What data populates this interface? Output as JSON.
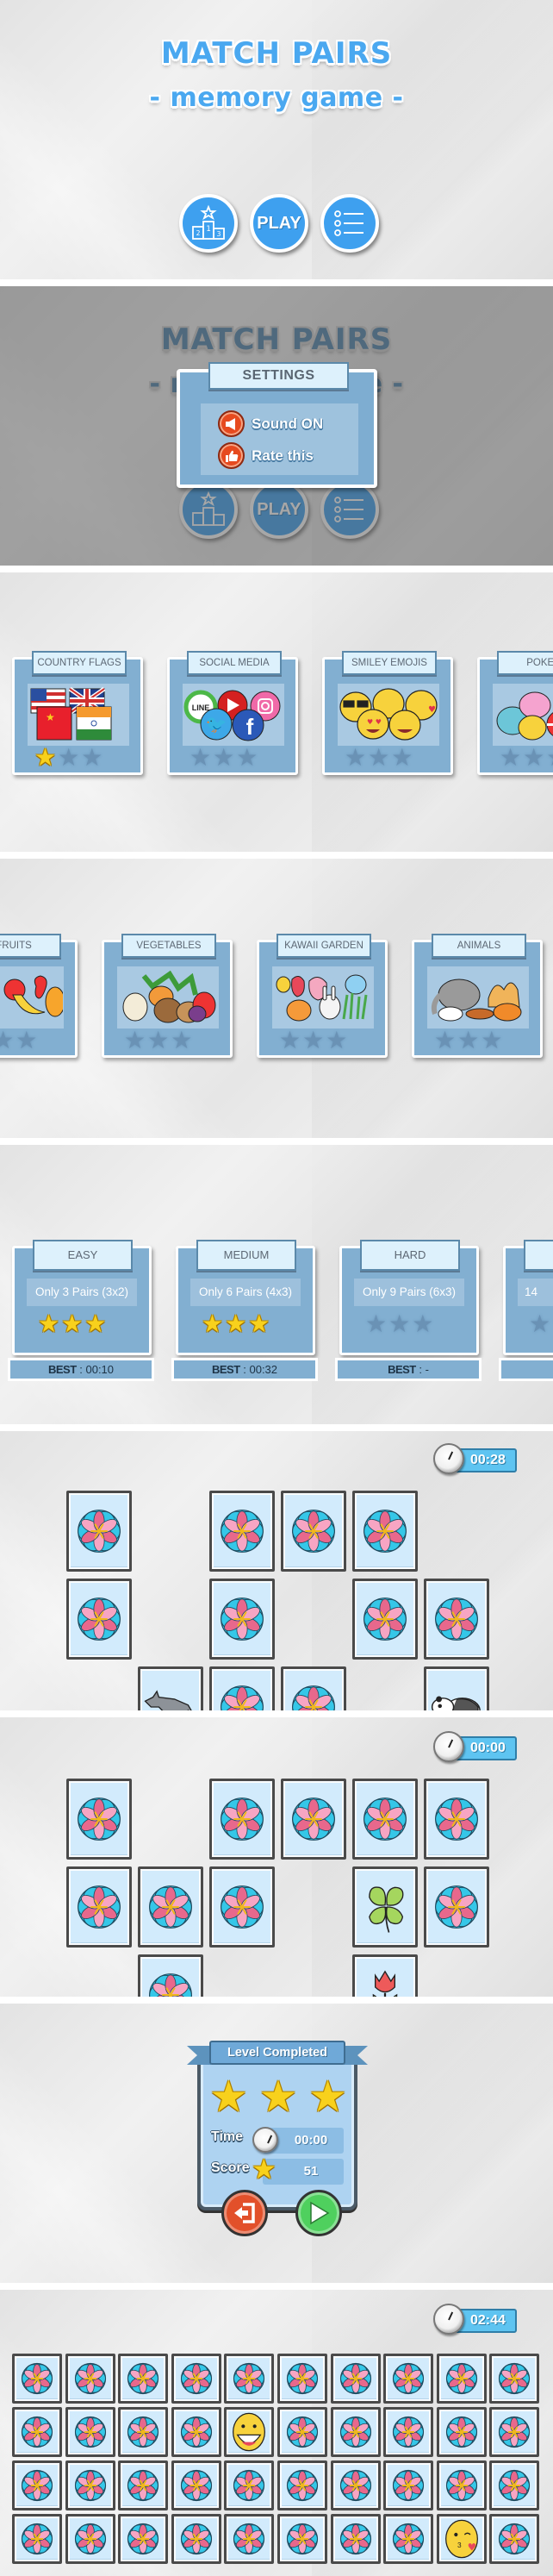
{
  "screens": {
    "main_menu": {
      "title": "MATCH PAIRS",
      "subtitle": "- memory game -",
      "buttons": {
        "leaderboard_icon": "podium-icon",
        "play_label": "PLAY",
        "menu_icon": "list-icon"
      }
    },
    "settings": {
      "title": "MATCH PAIRS",
      "subtitle": "- memory game -",
      "popup_title": "SETTINGS",
      "items": [
        {
          "label": "Sound ON",
          "icon": "speaker-icon"
        },
        {
          "label": "Rate this",
          "icon": "thumbs-up-icon"
        }
      ],
      "play_label": "PLAY"
    },
    "categories_1": {
      "cards": [
        {
          "title": "COUNTRY FLAGS",
          "stars": 1,
          "art": "flags"
        },
        {
          "title": "SOCIAL MEDIA",
          "stars": 0,
          "art": "social"
        },
        {
          "title": "SMILEY EMOJIS",
          "stars": 0,
          "art": "emoji"
        },
        {
          "title": "POKEM",
          "stars": 0,
          "art": "pokemon"
        }
      ]
    },
    "categories_2": {
      "cards": [
        {
          "title": "FRUITS",
          "stars": 0,
          "art": "fruits"
        },
        {
          "title": "VEGETABLES",
          "stars": 0,
          "art": "vegetables"
        },
        {
          "title": "KAWAII GARDEN",
          "stars": 0,
          "art": "garden"
        },
        {
          "title": "ANIMALS",
          "stars": 0,
          "art": "animals"
        }
      ]
    },
    "difficulty": {
      "best_label": "BEST",
      "cards": [
        {
          "title": "EASY",
          "desc": "Only 3 Pairs (3x2)",
          "stars": 3,
          "best": ": 00:10"
        },
        {
          "title": "MEDIUM",
          "desc": "Only 6 Pairs (4x3)",
          "stars": 3,
          "best": ": 00:32"
        },
        {
          "title": "HARD",
          "desc": "Only 9 Pairs (6x3)",
          "stars": 0,
          "best": ": -"
        },
        {
          "title": "",
          "desc": "14",
          "stars": 0,
          "best": ""
        }
      ]
    },
    "game_1": {
      "timer": "00:28",
      "columns": 6,
      "rows": [
        [
          "back",
          "",
          "back",
          "back",
          "back",
          ""
        ],
        [
          "back",
          "",
          "back",
          "",
          "back",
          "back"
        ],
        [
          "",
          "wolf",
          "back",
          "back",
          "",
          "panda"
        ]
      ]
    },
    "game_2": {
      "timer": "00:00",
      "columns": 6,
      "rows": [
        [
          "back",
          "",
          "back",
          "back",
          "back",
          "back"
        ],
        [
          "back",
          "back",
          "back",
          "",
          "clover",
          "back"
        ],
        [
          "",
          "back",
          "",
          "",
          "tulip",
          ""
        ]
      ]
    },
    "level_completed": {
      "title": "Level Completed",
      "stars": 3,
      "time_label": "Time",
      "time_value": "00:00",
      "score_label": "Score",
      "score_value": "51",
      "exit_icon": "exit-icon",
      "next_icon": "play-icon"
    },
    "game_3": {
      "timer": "02:44",
      "columns": 10,
      "rows": [
        [
          "back",
          "back",
          "back",
          "back",
          "back",
          "back",
          "back",
          "back",
          "back",
          "back"
        ],
        [
          "back",
          "back",
          "back",
          "back",
          "grin",
          "back",
          "back",
          "back",
          "back",
          "back"
        ],
        [
          "back",
          "back",
          "back",
          "back",
          "back",
          "back",
          "back",
          "back",
          "back",
          "back"
        ],
        [
          "back",
          "back",
          "back",
          "back",
          "back",
          "back",
          "back",
          "back",
          "kiss",
          "back"
        ]
      ]
    }
  },
  "colors": {
    "accent_blue": "#3ea0ef",
    "card_blue": "#82afd1",
    "header_light": "#ddf1fc",
    "tile_bg": "#d2ebfc",
    "star_gold": "#f8d11c",
    "star_off": "#6a92b5",
    "red_button": "#e2502a",
    "green_button": "#4fd05e",
    "timer_bar": "#5ec4f1"
  }
}
